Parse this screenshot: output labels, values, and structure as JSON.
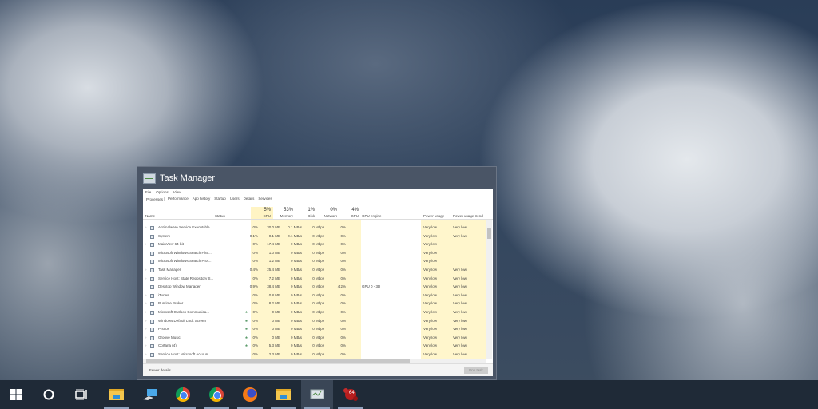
{
  "window": {
    "title": "Task Manager",
    "menu": [
      "File",
      "Options",
      "View"
    ],
    "tabs": [
      "Processes",
      "Performance",
      "App history",
      "Startup",
      "Users",
      "Details",
      "Services"
    ],
    "columns": {
      "name": "Name",
      "status": "Status",
      "cpu_pct": "5%",
      "cpu": "CPU",
      "mem_pct": "53%",
      "mem": "Memory",
      "disk_pct": "1%",
      "disk": "Disk",
      "net_pct": "0%",
      "net": "Network",
      "gpu_pct": "4%",
      "gpu": "GPU",
      "gpu_engine": "GPU engine",
      "power": "Power usage",
      "power_trend": "Power usage trend"
    },
    "rows": [
      {
        "name": "Antimalware Service Executable",
        "cpu": "0%",
        "mem": "30.0 MB",
        "disk": "0.1 MB/s",
        "net": "0 Mbps",
        "gpu": "0%",
        "engine": "",
        "power": "Very low",
        "trend": "Very low",
        "exp": true
      },
      {
        "name": "System",
        "cpu": "0.1%",
        "mem": "0.1 MB",
        "disk": "0.1 MB/s",
        "net": "0 Mbps",
        "gpu": "0%",
        "engine": "",
        "power": "Very low",
        "trend": "Very low",
        "exp": false
      },
      {
        "name": "MainView 64-bit",
        "cpu": "0%",
        "mem": "17.4 MB",
        "disk": "0 MB/s",
        "net": "0 Mbps",
        "gpu": "0%",
        "engine": "",
        "power": "Very low",
        "trend": "",
        "exp": true
      },
      {
        "name": "Microsoft Windows Search Filte...",
        "cpu": "0%",
        "mem": "1.0 MB",
        "disk": "0 MB/s",
        "net": "0 Mbps",
        "gpu": "0%",
        "engine": "",
        "power": "Very low",
        "trend": "",
        "exp": false
      },
      {
        "name": "Microsoft Windows Search Prot...",
        "cpu": "0%",
        "mem": "1.2 MB",
        "disk": "0 MB/s",
        "net": "0 Mbps",
        "gpu": "0%",
        "engine": "",
        "power": "Very low",
        "trend": "",
        "exp": false
      },
      {
        "name": "Task Manager",
        "cpu": "0.4%",
        "mem": "25.4 MB",
        "disk": "0 MB/s",
        "net": "0 Mbps",
        "gpu": "0%",
        "engine": "",
        "power": "Very low",
        "trend": "Very low",
        "exp": true
      },
      {
        "name": "Service Host: State Repository S...",
        "cpu": "0%",
        "mem": "7.2 MB",
        "disk": "0 MB/s",
        "net": "0 Mbps",
        "gpu": "0%",
        "engine": "",
        "power": "Very low",
        "trend": "Very low",
        "exp": true
      },
      {
        "name": "Desktop Window Manager",
        "cpu": "0.9%",
        "mem": "38.4 MB",
        "disk": "0 MB/s",
        "net": "0 Mbps",
        "gpu": "4.2%",
        "engine": "GPU 0 - 3D",
        "power": "Very low",
        "trend": "Very low",
        "exp": false
      },
      {
        "name": "iTunes",
        "cpu": "0%",
        "mem": "0.8 MB",
        "disk": "0 MB/s",
        "net": "0 Mbps",
        "gpu": "0%",
        "engine": "",
        "power": "Very low",
        "trend": "Very low",
        "exp": true
      },
      {
        "name": "Runtime Broker",
        "cpu": "0%",
        "mem": "8.2 MB",
        "disk": "0 MB/s",
        "net": "0 Mbps",
        "gpu": "0%",
        "engine": "",
        "power": "Very low",
        "trend": "Very low",
        "exp": true
      },
      {
        "name": "Microsoft Outlook Communica...",
        "cpu": "0%",
        "mem": "0 MB",
        "disk": "0 MB/s",
        "net": "0 Mbps",
        "gpu": "0%",
        "engine": "",
        "power": "Very low",
        "trend": "Very low",
        "exp": true,
        "leaf": true
      },
      {
        "name": "Windows Default Lock Screen",
        "cpu": "0%",
        "mem": "0 MB",
        "disk": "0 MB/s",
        "net": "0 Mbps",
        "gpu": "0%",
        "engine": "",
        "power": "Very low",
        "trend": "Very low",
        "exp": true,
        "leaf": true
      },
      {
        "name": "Photos",
        "cpu": "0%",
        "mem": "0 MB",
        "disk": "0 MB/s",
        "net": "0 Mbps",
        "gpu": "0%",
        "engine": "",
        "power": "Very low",
        "trend": "Very low",
        "exp": true,
        "leaf": true
      },
      {
        "name": "Groove Music",
        "cpu": "0%",
        "mem": "0 MB",
        "disk": "0 MB/s",
        "net": "0 Mbps",
        "gpu": "0%",
        "engine": "",
        "power": "Very low",
        "trend": "Very low",
        "exp": true,
        "leaf": true
      },
      {
        "name": "Cortana (4)",
        "cpu": "0%",
        "mem": "5.3 MB",
        "disk": "0 MB/s",
        "net": "0 Mbps",
        "gpu": "0%",
        "engine": "",
        "power": "Very low",
        "trend": "Very low",
        "exp": true,
        "leaf": true
      },
      {
        "name": "Service Host: Microsoft Accoun...",
        "cpu": "0%",
        "mem": "2.3 MB",
        "disk": "0 MB/s",
        "net": "0 Mbps",
        "gpu": "0%",
        "engine": "",
        "power": "Very low",
        "trend": "Very low",
        "exp": true
      }
    ],
    "fewer_details": "Fewer details",
    "end_task": "End task"
  },
  "taskbar": {
    "badge": "64"
  }
}
